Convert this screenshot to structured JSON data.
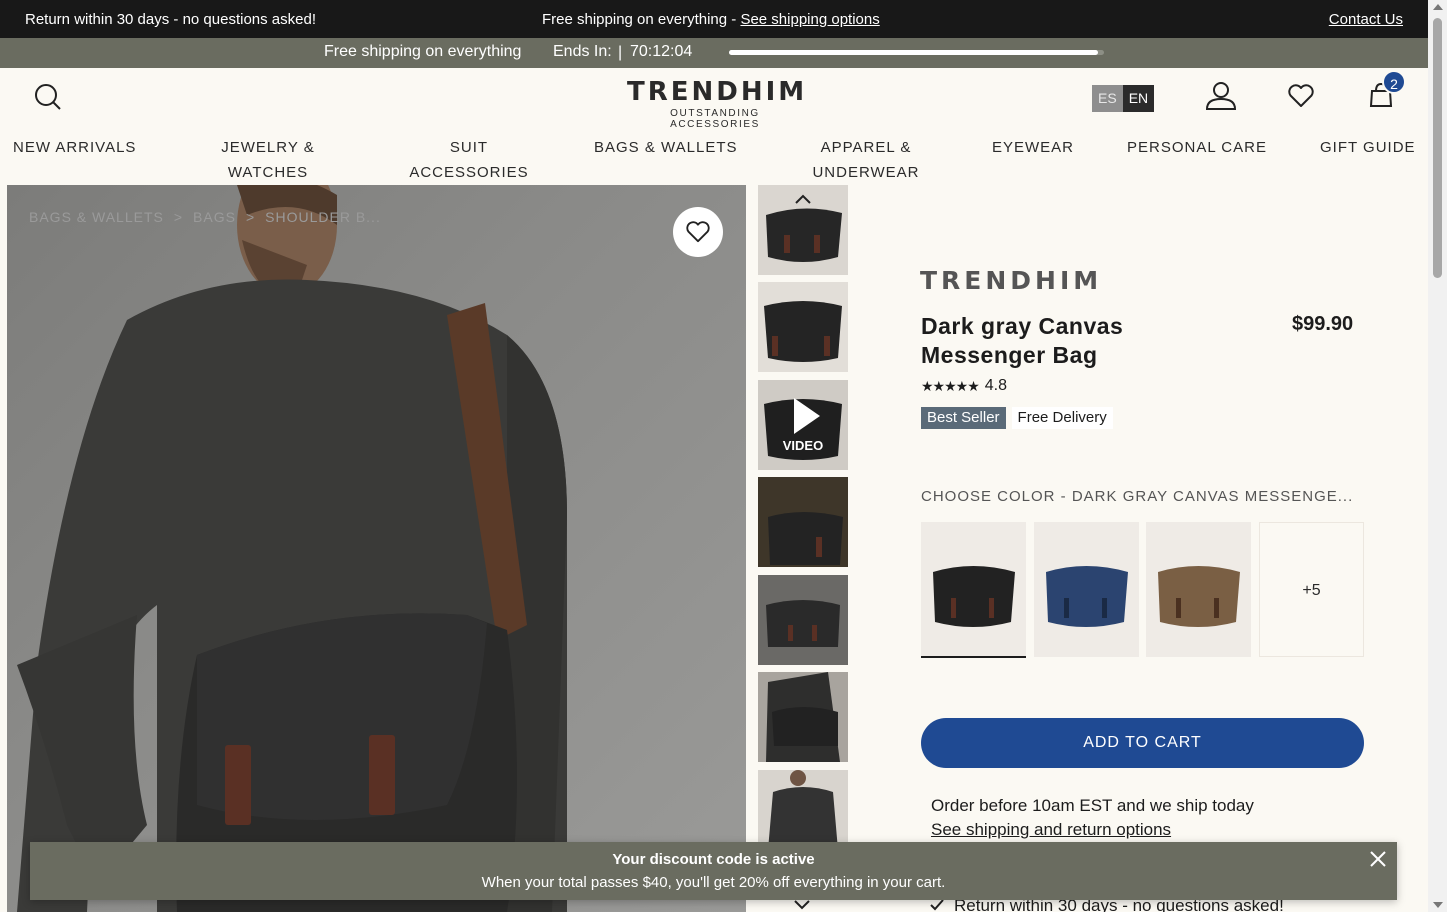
{
  "topbar": {
    "returns": "Return within 30 days - no questions asked!",
    "shipping_text": "Free shipping on everything - ",
    "shipping_link": "See shipping options",
    "contact": "Contact Us"
  },
  "countdown": {
    "message": "Free shipping on everything",
    "ends_label": "Ends In:",
    "separator": "|",
    "timer": "70:12:04",
    "progress": 0.985
  },
  "header": {
    "logo_name": "TRENDHIM",
    "logo_tagline": "OUTSTANDING ACCESSORIES",
    "lang_es": "ES",
    "lang_en": "EN",
    "cart_count": "2"
  },
  "nav": [
    {
      "label": "NEW ARRIVALS"
    },
    {
      "label": "JEWELRY &\nWATCHES"
    },
    {
      "label": "SUIT\nACCESSORIES"
    },
    {
      "label": "BAGS & WALLETS"
    },
    {
      "label": "APPAREL &\nUNDERWEAR"
    },
    {
      "label": "EYEWEAR"
    },
    {
      "label": "PERSONAL CARE"
    },
    {
      "label": "GIFT GUIDE"
    }
  ],
  "breadcrumb": [
    "BAGS & WALLETS",
    ">",
    "BAGS",
    ">",
    "SHOULDER B..."
  ],
  "thumbnails": {
    "video_label": "VIDEO"
  },
  "product": {
    "brand": "TRENDHIM",
    "title": "Dark gray Canvas Messenger Bag",
    "price": "$99.90",
    "stars": "★★★★★",
    "rating": "4.8",
    "badge_best": "Best Seller",
    "badge_delivery": "Free Delivery",
    "color_label": "CHOOSE COLOR - DARK GRAY CANVAS MESSENGE...",
    "more_colors": "+5",
    "add_to_cart": "ADD TO CART",
    "order_note": "Order before 10am EST and we ship today",
    "shipping_link": "See shipping and return options",
    "return_note": "Return within 30 days - no questions asked!"
  },
  "toast": {
    "title": "Your discount code is active",
    "message": "When your total passes $40, you'll get 20% off everything in your cart."
  },
  "colors": {
    "accent": "#1f4a93",
    "olive": "#6a6c60",
    "dark": "#181818",
    "background": "#fbf9f3"
  }
}
